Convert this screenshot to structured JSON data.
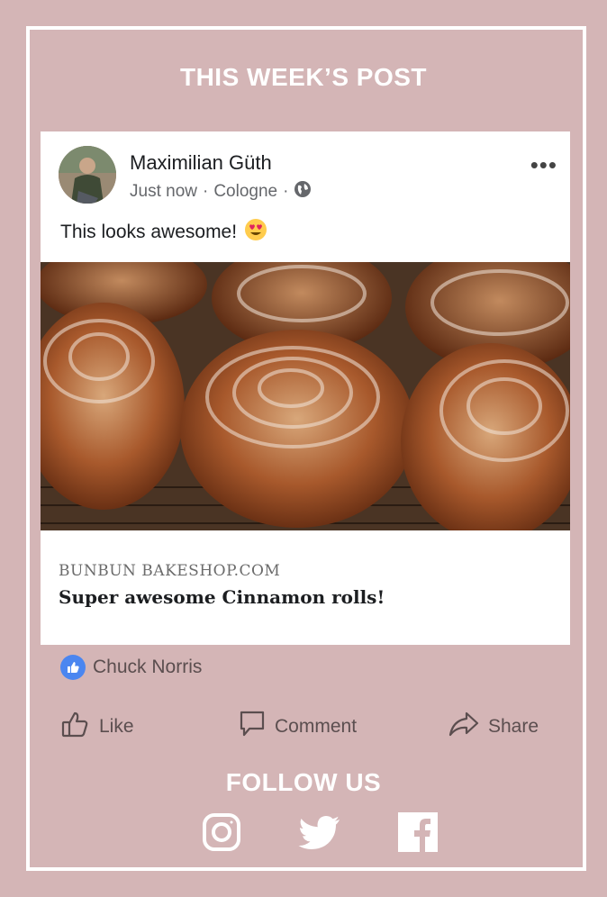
{
  "header": {
    "title": "THIS WEEK’S POST"
  },
  "post": {
    "author": "Maximilian Güth",
    "time": "Just now",
    "location": "Cologne",
    "separator": "·",
    "text": "This looks awesome!",
    "emoji": "😍",
    "more_icon": "more-dots-icon",
    "link_domain": "BUNBUN BAKESHOP.COM",
    "link_title": "Super awesome Cinnamon rolls!"
  },
  "reactions": {
    "liker": "Chuck Norris",
    "icon": "thumbs-up-icon"
  },
  "actions": {
    "like": "Like",
    "comment": "Comment",
    "share": "Share"
  },
  "footer": {
    "title": "FOLLOW US",
    "icons": [
      "instagram-icon",
      "twitter-icon",
      "facebook-icon"
    ]
  },
  "colors": {
    "background": "#d4b5b6",
    "frame": "#ffffff",
    "like_blue": "#4b86f0"
  }
}
